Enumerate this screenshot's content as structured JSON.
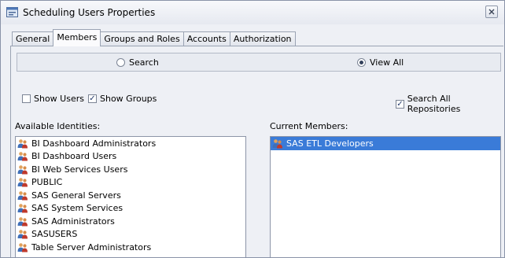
{
  "window": {
    "title": "Scheduling Users Properties",
    "icon": "properties-icon"
  },
  "tabs": [
    {
      "label": "General"
    },
    {
      "label": "Members",
      "active": true
    },
    {
      "label": "Groups and Roles"
    },
    {
      "label": "Accounts"
    },
    {
      "label": "Authorization"
    }
  ],
  "mode": {
    "search_label": "Search",
    "view_all_label": "View All",
    "selected": "View All"
  },
  "filters": {
    "show_users": {
      "label": "Show Users",
      "checked": false
    },
    "show_groups": {
      "label": "Show Groups",
      "checked": true
    },
    "search_all_repositories": {
      "label": "Search All Repositories",
      "checked": true
    }
  },
  "available": {
    "heading": "Available Identities:",
    "items": [
      "BI Dashboard Administrators",
      "BI Dashboard Users",
      "BI Web Services Users",
      "PUBLIC",
      "SAS General Servers",
      "SAS System Services",
      "SAS Administrators",
      "SASUSERS",
      "Table Server Administrators"
    ]
  },
  "current": {
    "heading": "Current Members:",
    "items": [
      "SAS ETL Developers"
    ],
    "selected_index": 0
  },
  "colors": {
    "selection": "#3a7bd8",
    "window_bg": "#eef0f5"
  }
}
